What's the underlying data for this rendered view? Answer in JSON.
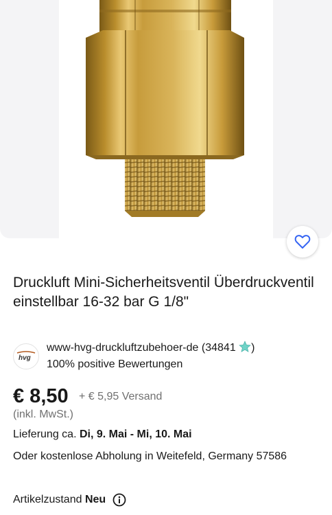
{
  "product": {
    "title": "Druckluft Mini-Sicherheitsventil Überdruckventil einstellbar 16-32 bar G 1/8\"",
    "image_icon": "brass-valve-photo"
  },
  "favorite": {
    "icon": "heart-icon"
  },
  "seller": {
    "logo_text": "hvg",
    "name": "www-hvg-druckluftzubehoer-de",
    "feedback_count": "(34841",
    "feedback_close": ")",
    "rating": "100% positive Bewertungen"
  },
  "pricing": {
    "price": "€ 8,50",
    "shipping": "+ € 5,95 Versand",
    "tax_note": "(inkl. MwSt.)"
  },
  "delivery": {
    "label": "Lieferung ca.",
    "dates": "Di, 9. Mai - Mi, 10. Mai"
  },
  "pickup": {
    "text": "Oder kostenlose Abholung in Weitefeld, Germany 57586"
  },
  "condition": {
    "label": "Artikelzustand",
    "value": "Neu",
    "info_icon": "info-icon"
  },
  "colors": {
    "text": "#191919",
    "secondary": "#707070",
    "accent_blue": "#3665f3",
    "brass": "#c9a44a"
  }
}
